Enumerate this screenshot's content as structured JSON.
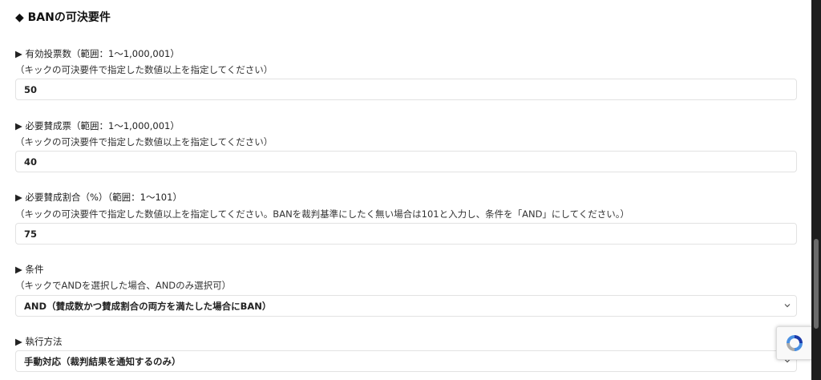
{
  "section": {
    "title": "◆ BANの可決要件"
  },
  "fields": [
    {
      "label": "▶ 有効投票数（範囲：1〜1,000,001）",
      "note": "（キックの可決要件で指定した数値以上を指定してください）",
      "value": "50"
    },
    {
      "label": "▶ 必要賛成票（範囲：1〜1,000,001）",
      "note": "（キックの可決要件で指定した数値以上を指定してください）",
      "value": "40"
    },
    {
      "label": "▶ 必要賛成割合（%）（範囲：1〜101）",
      "note": "（キックの可決要件で指定した数値以上を指定してください。BANを裁判基準にしたく無い場合は101と入力し、条件を「AND」にしてください。）",
      "value": "75"
    },
    {
      "label": "▶ 条件",
      "note": "（キックでANDを選択した場合、ANDのみ選択可）",
      "value": "AND（賛成数かつ賛成割合の両方を満たした場合にBAN）"
    },
    {
      "label": "▶ 執行方法",
      "value": "手動対応（裁判結果を通知するのみ）"
    }
  ],
  "icons": {
    "dropdown": "chevron-down-icon",
    "recaptcha": "recaptcha-icon"
  },
  "colors": {
    "field_border": "#e2e2e2",
    "scrollbar": "#1e1e1e",
    "recaptcha_blue": "#4a90e2"
  }
}
